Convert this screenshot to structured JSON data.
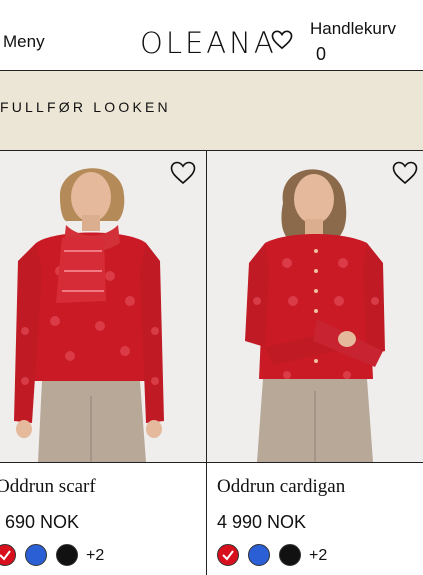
{
  "header": {
    "menu_label": "Meny",
    "logo_text": "OLEANA",
    "cart_label": "Handlekurv",
    "cart_count": "0"
  },
  "section": {
    "title": "FULLFØR LOOKEN"
  },
  "products": [
    {
      "name": "Oddrun scarf",
      "price": "690 NOK",
      "swatches": [
        "#d8101e",
        "#2b5fd6",
        "#111111"
      ],
      "selected_swatch": 0,
      "more": "+2"
    },
    {
      "name": "Oddrun cardigan",
      "price": "4 990 NOK",
      "swatches": [
        "#d8101e",
        "#2b5fd6",
        "#111111"
      ],
      "selected_swatch": 0,
      "more": "+2"
    }
  ],
  "colors": {
    "beige": "#ece6d6",
    "red": "#d8101e",
    "blue": "#2b5fd6",
    "black": "#111111"
  },
  "icons": [
    "heart-icon",
    "heart-outline-icon",
    "check-icon"
  ]
}
